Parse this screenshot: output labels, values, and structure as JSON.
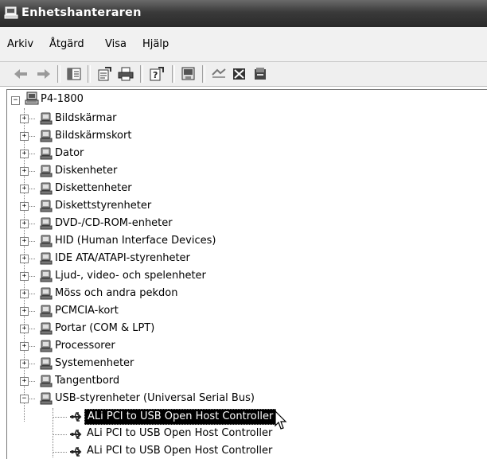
{
  "window": {
    "title": "Enhetshanteraren"
  },
  "menu": [
    "Arkiv",
    "Åtgärd",
    "Visa",
    "Hjälp"
  ],
  "toolbar": {
    "icons": [
      "back-arrow-icon",
      "forward-arrow-icon",
      "console-tree-icon",
      "properties-icon",
      "print-icon",
      "help-icon",
      "update-driver-icon",
      "uninstall-icon",
      "disable-device-icon",
      "scan-hardware-icon"
    ]
  },
  "tree": {
    "root": "P4-1800",
    "categories": [
      "Bildskärmar",
      "Bildskärmskort",
      "Dator",
      "Diskenheter",
      "Diskettenheter",
      "Diskettstyrenheter",
      "DVD-/CD-ROM-enheter",
      "HID (Human Interface Devices)",
      "IDE ATA/ATAPI-styrenheter",
      "Ljud-, video- och spelenheter",
      "Möss och andra pekdon",
      "PCMCIA-kort",
      "Portar (COM & LPT)",
      "Processorer",
      "Systemenheter",
      "Tangentbord",
      "USB-styrenheter (Universal Serial Bus)"
    ],
    "usb_children": [
      "ALi PCI to USB Open Host Controller",
      "ALi PCI to USB Open Host Controller",
      "ALi PCI to USB Open Host Controller"
    ],
    "expander_collapsed": "+",
    "expander_expanded": "−"
  }
}
